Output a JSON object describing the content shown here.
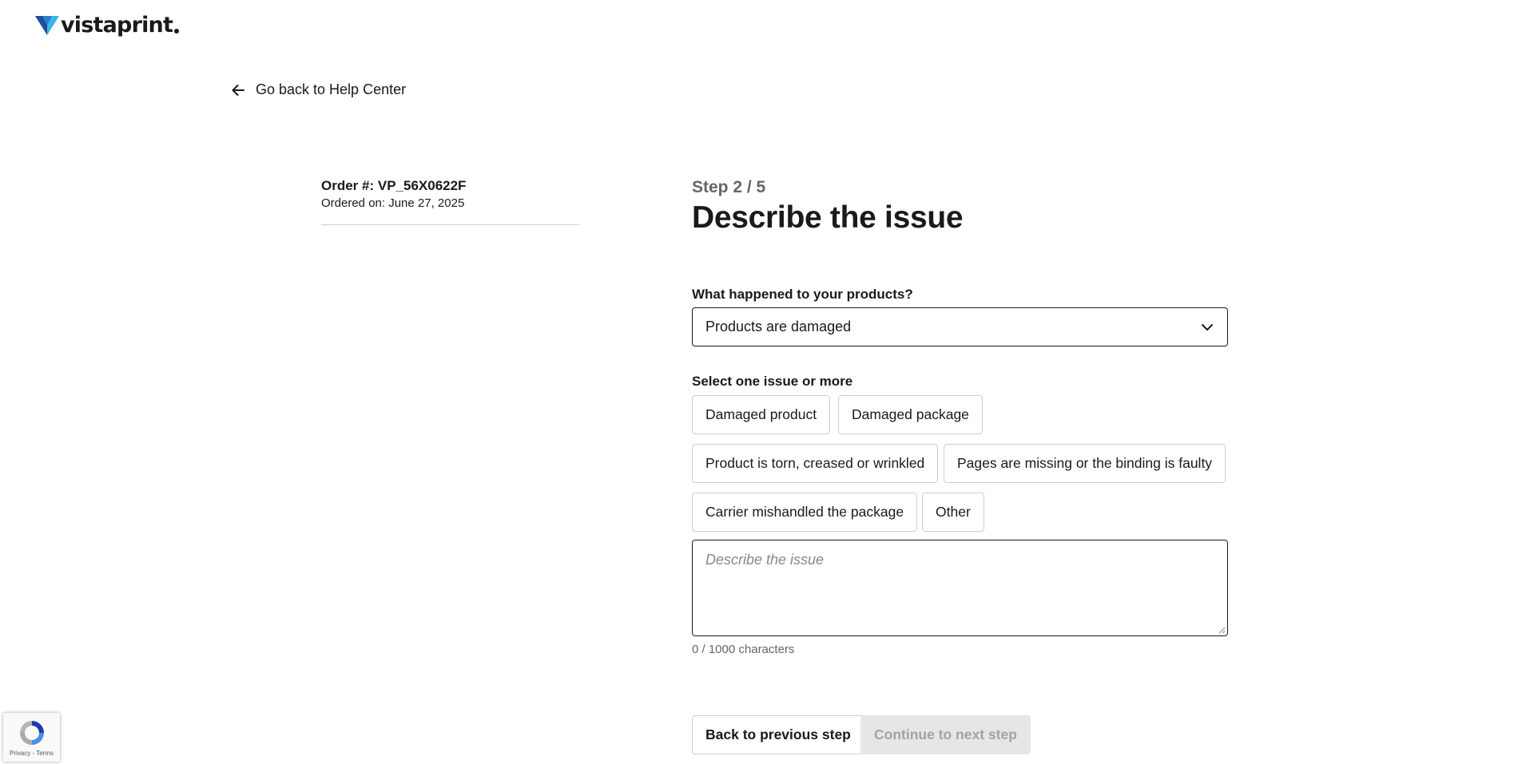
{
  "header": {
    "logo_text": "vistaprint"
  },
  "nav": {
    "back_to_help_label": "Go back to Help Center"
  },
  "order": {
    "number_label": "Order #: VP_56X0622F",
    "date_label": "Ordered on: June 27, 2025"
  },
  "step": {
    "progress_label": "Step 2 / 5",
    "current": 2,
    "total": 5,
    "title": "Describe the issue"
  },
  "form": {
    "question_label": "What happened to your products?",
    "selected_option": "Products are damaged",
    "issues_label": "Select one issue or more",
    "issues": [
      "Damaged product",
      "Damaged package",
      "Product is torn, creased or wrinkled",
      "Pages are missing or the binding is faulty",
      "Carrier mishandled the package",
      "Other"
    ],
    "description_placeholder": "Describe the issue",
    "char_count": "0 / 1000 characters"
  },
  "actions": {
    "back_label": "Back to previous step",
    "continue_label": "Continue to next step"
  },
  "recaptcha": {
    "links_text": "Privacy - Terms"
  },
  "colors": {
    "text": "#1a1a1a",
    "muted": "#666666",
    "disabled_bg": "#e6e6e6",
    "disabled_text": "#a3a3a3",
    "logo_blue": "#1e4e9d",
    "logo_cyan": "#39b5e6"
  },
  "icons": {
    "back": "arrow-left-icon",
    "select": "chevron-down-icon",
    "logo": "vistaprint-logo-icon",
    "recaptcha": "recaptcha-logo-icon"
  }
}
